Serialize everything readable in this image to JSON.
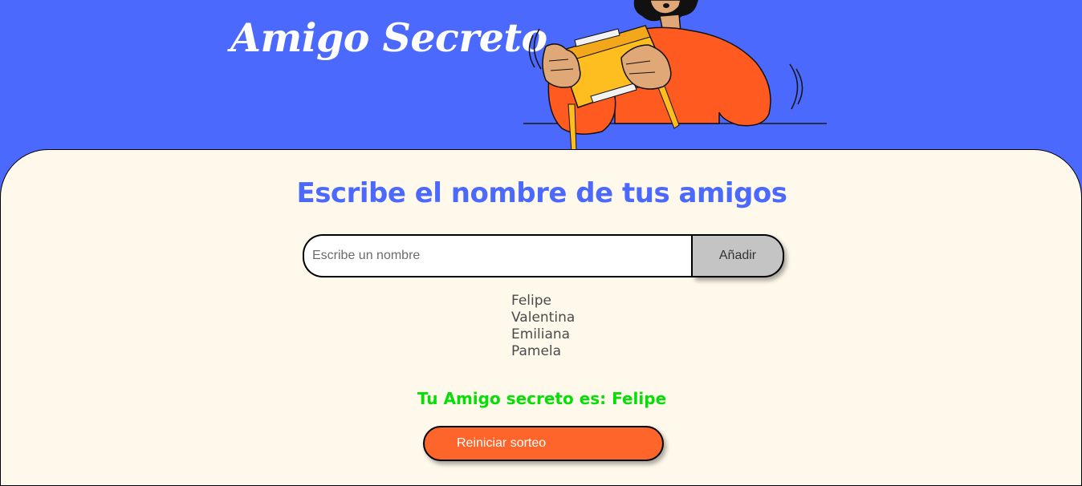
{
  "header": {
    "title": "Amigo Secreto",
    "illustration": "person-opening-gift-box"
  },
  "main": {
    "heading": "Escribe el nombre de tus amigos",
    "input": {
      "placeholder": "Escribe un nombre",
      "value": ""
    },
    "add_button_label": "Añadir",
    "friends": [
      "Felipe",
      "Valentina",
      "Emiliana",
      "Pamela"
    ],
    "result_text": "Tu Amigo secreto es: Felipe",
    "reset_button_label": "Reiniciar sorteo"
  },
  "colors": {
    "header_background": "#4b69fd",
    "panel_background": "#fff9eb",
    "heading_color": "#4b69fd",
    "result_color": "#05df05",
    "reset_button_color": "#fe652b",
    "add_button_color": "#c4c4c4"
  }
}
